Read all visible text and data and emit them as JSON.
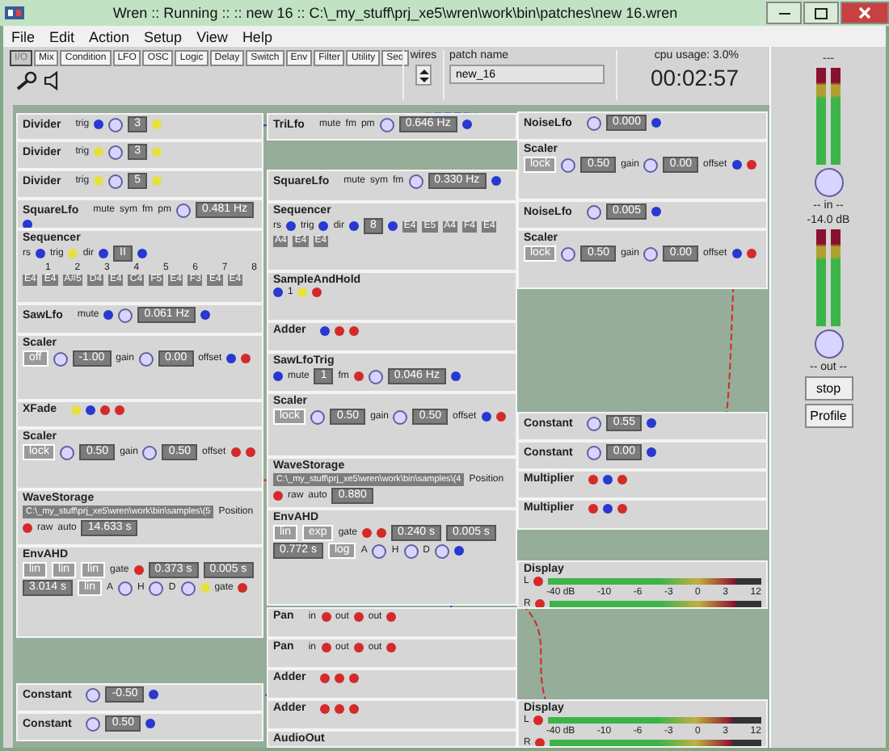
{
  "window": {
    "title": "Wren :: Running :: :: new 16 :: C:\\_my_stuff\\prj_xe5\\wren\\work\\bin\\patches\\new 16.wren"
  },
  "menu": [
    "File",
    "Edit",
    "Action",
    "Setup",
    "View",
    "Help"
  ],
  "tabs": [
    {
      "label": "I/O",
      "selected": true
    },
    {
      "label": "Mix",
      "selected": false
    },
    {
      "label": "Condition",
      "selected": false
    },
    {
      "label": "LFO",
      "selected": false
    },
    {
      "label": "OSC",
      "selected": false
    },
    {
      "label": "Logic",
      "selected": false
    },
    {
      "label": "Delay",
      "selected": false
    },
    {
      "label": "Switch",
      "selected": false
    },
    {
      "label": "Env",
      "selected": false
    },
    {
      "label": "Filter",
      "selected": false
    },
    {
      "label": "Utility",
      "selected": false
    },
    {
      "label": "Seq",
      "selected": false
    }
  ],
  "wires_label": "wires",
  "patch_name": {
    "label": "patch name",
    "value": "new_16"
  },
  "cpu_usage": "cpu usage: 3.0%",
  "time": "00:02:57",
  "columns": [
    [
      {
        "title": "Divider",
        "items": [
          {
            "kind": "label",
            "text": "trig"
          },
          {
            "kind": "port",
            "color": "#2838d0"
          },
          {
            "kind": "knob"
          },
          {
            "kind": "value",
            "text": "3"
          },
          {
            "kind": "port",
            "color": "#e8e040"
          }
        ]
      },
      {
        "title": "Divider",
        "items": [
          {
            "kind": "label",
            "text": "trig"
          },
          {
            "kind": "port",
            "color": "#e8e040"
          },
          {
            "kind": "knob"
          },
          {
            "kind": "value",
            "text": "3"
          },
          {
            "kind": "port",
            "color": "#e8e040"
          }
        ]
      },
      {
        "title": "Divider",
        "items": [
          {
            "kind": "label",
            "text": "trig"
          },
          {
            "kind": "port",
            "color": "#e8e040"
          },
          {
            "kind": "knob"
          },
          {
            "kind": "value",
            "text": "5"
          },
          {
            "kind": "port",
            "color": "#e8e040"
          }
        ]
      },
      {
        "title": "SquareLfo",
        "items": [
          {
            "kind": "label",
            "text": "mute"
          },
          {
            "kind": "label",
            "text": "sym"
          },
          {
            "kind": "label",
            "text": "fm"
          },
          {
            "kind": "label",
            "text": "pm"
          },
          {
            "kind": "knob"
          },
          {
            "kind": "value",
            "text": "0.481 Hz"
          },
          {
            "kind": "port",
            "color": "#2838d0"
          }
        ]
      },
      {
        "title": "Sequencer",
        "items": [
          {
            "kind": "label",
            "text": "rs"
          },
          {
            "kind": "port",
            "color": "#2838d0"
          },
          {
            "kind": "label",
            "text": "trig"
          },
          {
            "kind": "port",
            "color": "#e8e040"
          },
          {
            "kind": "label",
            "text": "dir"
          },
          {
            "kind": "port",
            "color": "#2838d0"
          },
          {
            "kind": "value",
            "text": "II"
          },
          {
            "kind": "port",
            "color": "#2838d0"
          },
          {
            "kind": "scale",
            "ticks": [
              "1",
              "2",
              "3",
              "4",
              "5",
              "6",
              "7",
              "8"
            ]
          },
          {
            "kind": "note",
            "text": "E4"
          },
          {
            "kind": "note",
            "text": "E4"
          },
          {
            "kind": "note",
            "text": "A#5"
          },
          {
            "kind": "note",
            "text": "D4"
          },
          {
            "kind": "note",
            "text": "E4"
          },
          {
            "kind": "note",
            "text": "C4"
          },
          {
            "kind": "note",
            "text": "F5"
          },
          {
            "kind": "note",
            "text": "E4"
          },
          {
            "kind": "note",
            "text": "F3"
          },
          {
            "kind": "note",
            "text": "E4"
          },
          {
            "kind": "note",
            "text": "E4"
          }
        ]
      },
      {
        "title": "SawLfo",
        "items": [
          {
            "kind": "label",
            "text": "mute"
          },
          {
            "kind": "port",
            "color": "#2838d0"
          },
          {
            "kind": "knob"
          },
          {
            "kind": "value",
            "text": "0.061 Hz"
          },
          {
            "kind": "port",
            "color": "#2838d0"
          }
        ]
      },
      {
        "title": "Scaler",
        "items": [
          {
            "kind": "button",
            "text": "off"
          },
          {
            "kind": "knob"
          },
          {
            "kind": "value",
            "text": "-1.00"
          },
          {
            "kind": "label",
            "text": "gain"
          },
          {
            "kind": "knob"
          },
          {
            "kind": "value",
            "text": "0.00"
          },
          {
            "kind": "label",
            "text": "offset"
          },
          {
            "kind": "port",
            "color": "#2838d0"
          },
          {
            "kind": "port",
            "color": "#d42a2a"
          }
        ]
      },
      {
        "title": "XFade",
        "items": [
          {
            "kind": "port",
            "color": "#e8e040"
          },
          {
            "kind": "port",
            "color": "#2838d0"
          },
          {
            "kind": "port",
            "color": "#d42a2a"
          },
          {
            "kind": "port",
            "color": "#d42a2a"
          }
        ]
      },
      {
        "title": "Scaler",
        "items": [
          {
            "kind": "button",
            "text": "lock"
          },
          {
            "kind": "knob"
          },
          {
            "kind": "value",
            "text": "0.50"
          },
          {
            "kind": "label",
            "text": "gain"
          },
          {
            "kind": "knob"
          },
          {
            "kind": "value",
            "text": "0.50"
          },
          {
            "kind": "label",
            "text": "offset"
          },
          {
            "kind": "port",
            "color": "#d42a2a"
          },
          {
            "kind": "port",
            "color": "#d42a2a"
          }
        ]
      },
      {
        "title": "WaveStorage",
        "items": [
          {
            "kind": "path",
            "text": "C:\\_my_stuff\\prj_xe5\\wren\\work\\bin\\samples\\(5"
          },
          {
            "kind": "label",
            "text": "Position"
          },
          {
            "kind": "port",
            "color": "#d42a2a"
          },
          {
            "kind": "label",
            "text": "raw"
          },
          {
            "kind": "label",
            "text": "auto"
          },
          {
            "kind": "value",
            "text": "14.633 s"
          }
        ]
      },
      {
        "title": "EnvAHD",
        "items": [
          {
            "kind": "button",
            "text": "lin"
          },
          {
            "kind": "button",
            "text": "lin"
          },
          {
            "kind": "button",
            "text": "lin"
          },
          {
            "kind": "label",
            "text": "gate"
          },
          {
            "kind": "port",
            "color": "#d42a2a"
          },
          {
            "kind": "value",
            "text": "0.373 s"
          },
          {
            "kind": "value",
            "text": "0.005 s"
          },
          {
            "kind": "value",
            "text": "3.014 s"
          },
          {
            "kind": "button",
            "text": "lin"
          },
          {
            "kind": "label",
            "text": "A"
          },
          {
            "kind": "knob"
          },
          {
            "kind": "label",
            "text": "H"
          },
          {
            "kind": "knob"
          },
          {
            "kind": "label",
            "text": "D"
          },
          {
            "kind": "knob"
          },
          {
            "kind": "port",
            "color": "#e8e040"
          },
          {
            "kind": "label",
            "text": "gate"
          },
          {
            "kind": "port",
            "color": "#d42a2a"
          }
        ]
      },
      {
        "title": "Constant",
        "items": [
          {
            "kind": "knob"
          },
          {
            "kind": "value",
            "text": "-0.50"
          },
          {
            "kind": "port",
            "color": "#2838d0"
          }
        ]
      },
      {
        "title": "Constant",
        "items": [
          {
            "kind": "knob"
          },
          {
            "kind": "value",
            "text": "0.50"
          },
          {
            "kind": "port",
            "color": "#2838d0"
          }
        ]
      }
    ],
    [
      {
        "title": "TriLfo",
        "items": [
          {
            "kind": "label",
            "text": "mute"
          },
          {
            "kind": "label",
            "text": "fm"
          },
          {
            "kind": "label",
            "text": "pm"
          },
          {
            "kind": "knob"
          },
          {
            "kind": "value",
            "text": "0.646 Hz"
          },
          {
            "kind": "port",
            "color": "#2838d0"
          }
        ]
      },
      {
        "title": "SquareLfo",
        "items": [
          {
            "kind": "label",
            "text": "mute"
          },
          {
            "kind": "label",
            "text": "sym"
          },
          {
            "kind": "label",
            "text": "fm"
          },
          {
            "kind": "knob"
          },
          {
            "kind": "value",
            "text": "0.330 Hz"
          },
          {
            "kind": "port",
            "color": "#2838d0"
          }
        ]
      },
      {
        "title": "Sequencer",
        "items": [
          {
            "kind": "label",
            "text": "rs"
          },
          {
            "kind": "port",
            "color": "#2838d0"
          },
          {
            "kind": "label",
            "text": "trig"
          },
          {
            "kind": "port",
            "color": "#2838d0"
          },
          {
            "kind": "label",
            "text": "dir"
          },
          {
            "kind": "port",
            "color": "#2838d0"
          },
          {
            "kind": "value",
            "text": "8"
          },
          {
            "kind": "port",
            "color": "#2838d0"
          },
          {
            "kind": "note",
            "text": "E4"
          },
          {
            "kind": "note",
            "text": "E5"
          },
          {
            "kind": "note",
            "text": "A4"
          },
          {
            "kind": "note",
            "text": "F4"
          },
          {
            "kind": "note",
            "text": "E4"
          },
          {
            "kind": "note",
            "text": "A4"
          },
          {
            "kind": "note",
            "text": "E4"
          },
          {
            "kind": "note",
            "text": "E4"
          }
        ]
      },
      {
        "title": "SampleAndHold",
        "items": [
          {
            "kind": "port",
            "color": "#2838d0"
          },
          {
            "kind": "label",
            "text": "1"
          },
          {
            "kind": "port",
            "color": "#e8e040"
          },
          {
            "kind": "port",
            "color": "#d42a2a"
          }
        ]
      },
      {
        "title": "Adder",
        "items": [
          {
            "kind": "port",
            "color": "#2838d0"
          },
          {
            "kind": "port",
            "color": "#d42a2a"
          },
          {
            "kind": "port",
            "color": "#d42a2a"
          }
        ]
      },
      {
        "title": "SawLfoTrig",
        "items": [
          {
            "kind": "port",
            "color": "#2838d0"
          },
          {
            "kind": "label",
            "text": "mute"
          },
          {
            "kind": "value",
            "text": "1"
          },
          {
            "kind": "label",
            "text": "fm"
          },
          {
            "kind": "port",
            "color": "#d42a2a"
          },
          {
            "kind": "knob"
          },
          {
            "kind": "value",
            "text": "0.046 Hz"
          },
          {
            "kind": "port",
            "color": "#2838d0"
          }
        ]
      },
      {
        "title": "Scaler",
        "items": [
          {
            "kind": "button",
            "text": "lock"
          },
          {
            "kind": "knob"
          },
          {
            "kind": "value",
            "text": "0.50"
          },
          {
            "kind": "label",
            "text": "gain"
          },
          {
            "kind": "knob"
          },
          {
            "kind": "value",
            "text": "0.50"
          },
          {
            "kind": "label",
            "text": "offset"
          },
          {
            "kind": "port",
            "color": "#2838d0"
          },
          {
            "kind": "port",
            "color": "#d42a2a"
          }
        ]
      },
      {
        "title": "WaveStorage",
        "items": [
          {
            "kind": "path",
            "text": "C:\\_my_stuff\\prj_xe5\\wren\\work\\bin\\samples\\(4"
          },
          {
            "kind": "label",
            "text": "Position"
          },
          {
            "kind": "port",
            "color": "#d42a2a"
          },
          {
            "kind": "label",
            "text": "raw"
          },
          {
            "kind": "label",
            "text": "auto"
          },
          {
            "kind": "value",
            "text": "0.880"
          }
        ]
      },
      {
        "title": "EnvAHD",
        "items": [
          {
            "kind": "button",
            "text": "lin"
          },
          {
            "kind": "button",
            "text": "exp"
          },
          {
            "kind": "label",
            "text": "gate"
          },
          {
            "kind": "port",
            "color": "#d42a2a"
          },
          {
            "kind": "port",
            "color": "#d42a2a"
          },
          {
            "kind": "value",
            "text": "0.240 s"
          },
          {
            "kind": "value",
            "text": "0.005 s"
          },
          {
            "kind": "value",
            "text": "0.772 s"
          },
          {
            "kind": "button",
            "text": "log"
          },
          {
            "kind": "label",
            "text": "A"
          },
          {
            "kind": "knob"
          },
          {
            "kind": "label",
            "text": "H"
          },
          {
            "kind": "knob"
          },
          {
            "kind": "label",
            "text": "D"
          },
          {
            "kind": "knob"
          },
          {
            "kind": "port",
            "color": "#2838d0"
          }
        ]
      },
      {
        "title": "Pan",
        "items": [
          {
            "kind": "label",
            "text": "in"
          },
          {
            "kind": "port",
            "color": "#d42a2a"
          },
          {
            "kind": "label",
            "text": "out"
          },
          {
            "kind": "port",
            "color": "#d42a2a"
          },
          {
            "kind": "label",
            "text": "out"
          },
          {
            "kind": "port",
            "color": "#d42a2a"
          }
        ]
      },
      {
        "title": "Pan",
        "items": [
          {
            "kind": "label",
            "text": "in"
          },
          {
            "kind": "port",
            "color": "#d42a2a"
          },
          {
            "kind": "label",
            "text": "out"
          },
          {
            "kind": "port",
            "color": "#d42a2a"
          },
          {
            "kind": "label",
            "text": "out"
          },
          {
            "kind": "port",
            "color": "#d42a2a"
          }
        ]
      },
      {
        "title": "Adder",
        "items": [
          {
            "kind": "port",
            "color": "#d42a2a"
          },
          {
            "kind": "port",
            "color": "#d42a2a"
          },
          {
            "kind": "port",
            "color": "#d42a2a"
          }
        ]
      },
      {
        "title": "Adder",
        "items": [
          {
            "kind": "port",
            "color": "#d42a2a"
          },
          {
            "kind": "port",
            "color": "#d42a2a"
          },
          {
            "kind": "port",
            "color": "#d42a2a"
          }
        ]
      },
      {
        "title": "AudioOut"
      }
    ],
    [
      {
        "title": "NoiseLfo",
        "items": [
          {
            "kind": "knob"
          },
          {
            "kind": "value",
            "text": "0.000"
          },
          {
            "kind": "port",
            "color": "#2838d0"
          }
        ]
      },
      {
        "title": "Scaler",
        "items": [
          {
            "kind": "button",
            "text": "lock"
          },
          {
            "kind": "knob"
          },
          {
            "kind": "value",
            "text": "0.50"
          },
          {
            "kind": "label",
            "text": "gain"
          },
          {
            "kind": "knob"
          },
          {
            "kind": "value",
            "text": "0.00"
          },
          {
            "kind": "label",
            "text": "offset"
          },
          {
            "kind": "port",
            "color": "#2838d0"
          },
          {
            "kind": "port",
            "color": "#d42a2a"
          }
        ]
      },
      {
        "title": "NoiseLfo",
        "items": [
          {
            "kind": "knob"
          },
          {
            "kind": "value",
            "text": "0.005"
          },
          {
            "kind": "port",
            "color": "#2838d0"
          }
        ]
      },
      {
        "title": "Scaler",
        "items": [
          {
            "kind": "button",
            "text": "lock"
          },
          {
            "kind": "knob"
          },
          {
            "kind": "value",
            "text": "0.50"
          },
          {
            "kind": "label",
            "text": "gain"
          },
          {
            "kind": "knob"
          },
          {
            "kind": "value",
            "text": "0.00"
          },
          {
            "kind": "label",
            "text": "offset"
          },
          {
            "kind": "port",
            "color": "#2838d0"
          },
          {
            "kind": "port",
            "color": "#d42a2a"
          }
        ]
      },
      {
        "title": "Constant",
        "items": [
          {
            "kind": "knob"
          },
          {
            "kind": "value",
            "text": "0.55"
          },
          {
            "kind": "port",
            "color": "#2838d0"
          }
        ]
      },
      {
        "title": "Constant",
        "items": [
          {
            "kind": "knob"
          },
          {
            "kind": "value",
            "text": "0.00"
          },
          {
            "kind": "port",
            "color": "#2838d0"
          }
        ]
      },
      {
        "title": "Multiplier",
        "items": [
          {
            "kind": "port",
            "color": "#d42a2a"
          },
          {
            "kind": "port",
            "color": "#2838d0"
          },
          {
            "kind": "port",
            "color": "#d42a2a"
          }
        ]
      },
      {
        "title": "Multiplier",
        "items": [
          {
            "kind": "port",
            "color": "#d42a2a"
          },
          {
            "kind": "port",
            "color": "#2838d0"
          },
          {
            "kind": "port",
            "color": "#d42a2a"
          }
        ]
      },
      {
        "title": "Display",
        "items": [
          {
            "kind": "label",
            "text": "L"
          },
          {
            "kind": "port",
            "color": "#d42a2a"
          },
          {
            "kind": "meter",
            "level": 0.88
          },
          {
            "kind": "scale",
            "ticks": [
              "-40 dB",
              "-10",
              "-6",
              "-3",
              "0",
              "3",
              "12"
            ]
          },
          {
            "kind": "label",
            "text": "R"
          },
          {
            "kind": "port",
            "color": "#d42a2a"
          },
          {
            "kind": "meter",
            "level": 0.88
          }
        ]
      },
      {
        "title": "Display",
        "items": [
          {
            "kind": "label",
            "text": "L"
          },
          {
            "kind": "port",
            "color": "#d42a2a"
          },
          {
            "kind": "meter",
            "level": 0.86
          },
          {
            "kind": "scale",
            "ticks": [
              "-40 dB",
              "-10",
              "-6",
              "-3",
              "0",
              "3",
              "12"
            ]
          },
          {
            "kind": "label",
            "text": "R"
          },
          {
            "kind": "port",
            "color": "#d42a2a"
          },
          {
            "kind": "meter",
            "level": 0.86
          }
        ]
      }
    ]
  ],
  "side_panel": {
    "top_label": "---",
    "meters_in": [
      {
        "level": 1.0
      },
      {
        "level": 1.0
      }
    ],
    "in_label": "-- in --",
    "gain_reading": "-14.0 dB",
    "meters_out": [
      {
        "level": 1.0
      },
      {
        "level": 1.0
      }
    ],
    "out_label": "-- out --",
    "buttons": [
      "stop",
      "Profile"
    ]
  }
}
